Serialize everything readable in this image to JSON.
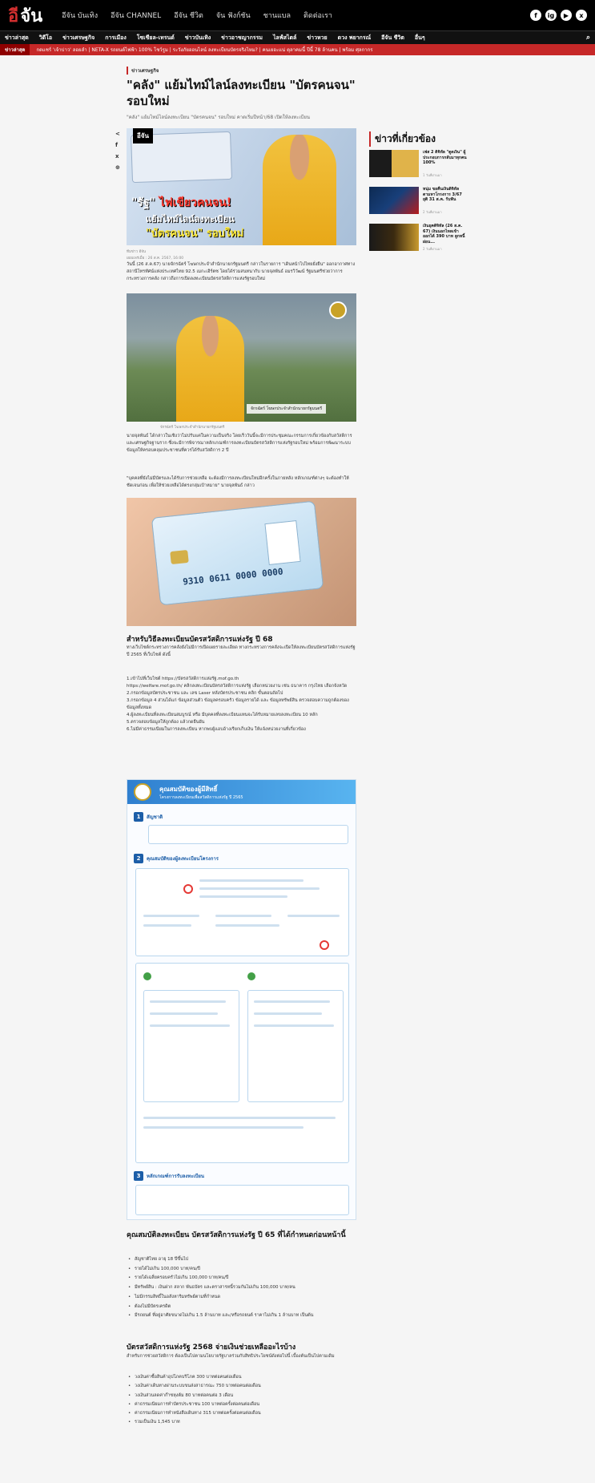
{
  "site": {
    "logo_mark": "อี",
    "logo_text": "จัน",
    "top_links": [
      "อีจัน บันเทิง",
      "อีจัน CHANNEL",
      "อีจัน ชีวิต",
      "จัน ฟังก์ชัน",
      "ชานแบล",
      "ติดต่อเรา"
    ],
    "social_icons": [
      "f",
      "ig",
      "▶",
      "x"
    ]
  },
  "nav": {
    "items": [
      "ข่าวล่าสุด",
      "วิดีโอ",
      "ข่าวเศรษฐกิจ",
      "การเมือง",
      "โซเชียล-เทรนด์",
      "ข่าวบันเทิง",
      "ข่าวอาชญากรรม",
      "ไลฟ์สไตล์",
      "ข่าวหวย",
      "ดวง พยากรณ์",
      "อีจัน ชีวิต",
      "อื่นๆ"
    ],
    "search_icon": "⌕"
  },
  "ticker": {
    "label": "ข่าวล่าสุด",
    "text": "กดแชร์ 'เจ้าบ่าว' ลอยลำ | NETA-X รถยนต์ไฟฟ้า 100% โชว์รูม | ระวังภัยออนไลน์ ลงทะเบียนบัตรจริงไหม? | คนเยอะแน่ ตุลาคมนี้ ปีนี้ 78 ล้านคน | พร้อม ศุลกากร"
  },
  "article": {
    "category": "ข่าวเศรษฐกิจ",
    "title": "\"คลัง\" แย้มไทม์ไลน์ลงทะเบียน \"บัตรคนจน\" รอบใหม่",
    "subtitle": "\"คลัง\" แย้มไทม์ไลน์ลงทะเบียน \"บัตรคนจน\" รอบใหม่ คาดเริ่มปีหน้า/68 เปิดให้ลงทะเบียน",
    "share_icons": [
      "<",
      "f",
      "x",
      "⊕"
    ],
    "hero": {
      "ribbon": "อีจัน",
      "line1_a": "\"รัฐ\"",
      "line1_b": "ไฟเขียวคนจน!",
      "line2": "แย้มไทม์ไลน์ลงทะเบียน",
      "line3": "\"บัตรคนจน\" รอบใหม่"
    },
    "meta_author": "ทีมข่าว อีจัน",
    "meta_date": "เผยแพร่เมื่อ : 26 ส.ค. 2567, 16:00",
    "p1": "วันนี้ (26 ส.ค.67) นายจักรฉัตร์ โฆษกประจำสำนักนายกรัฐมนตรี กล่าวในรายการ \"เดินหน้าไปไทยยั่งยืน\" ออกอากาศทางสถานีโทรทัศน์แห่งประเทศไทย 92.5 เมกะเฮิร์ตซ โดยได้ร่วมสนทนากับ นายจุลพันธ์ อมรวิวัฒน์ รัฐมนตรีช่วยว่าการกระทรวงการคลัง กล่าวถึงการเปิดลงทะเบียนบัตรสวัสดิการแห่งรัฐรอบใหม่",
    "img2_lower": "จักรฉัตร์ โฆษกประจำสำนักนายกรัฐมนตรี",
    "caption": "จักรฉัตร์ โฆษกประจำสำนักนายกรัฐมนตรี",
    "p2": "นายจุลพันธ์ ได้กล่าวในเชิงว่าไม่ปรับแค่ในความเป็นจริง โดยเร็ววันนี้จะมีการประชุมคณะกรรมการเกี่ยวข้องกับสวัสดิการและเศรษฐกิจฐานราก ซึ่งจะมีการพิจารณาหลักเกณฑ์การลงทะเบียนบัตรสวัสดิการแห่งรัฐรอบใหม่ พร้อมการพัฒนาระบบข้อมูลให้ครอบคลุมประชาชนที่ควรได้รับสวัสดิการ 2 ปี",
    "p3": "\"บุคคลที่ยังไม่มีบัตรและได้รับการช่วยเหลือ จะต้องมีการลงทะเบียนใหม่อีกครั้งในภายหลัง หลักเกณฑ์ต่างๆ จะต้องทำให้ชัดเจนก่อน เพื่อให้ช่วยเหลือได้ตรงกลุ่มเป้าหมาย\" นายจุลพันธ์ กล่าว",
    "card_number": "9310 0611 0000 0000",
    "sec1_title": "สำหรับวิธีลงทะเบียนบัตรสวัสดิการแห่งรัฐ ปี 68",
    "sec1_p": "ทางเว็บไซต์กระทรวงการคลังยังไม่มีการเปิดเผยรายละเอียด ทางกระทรวงการคลังจะเปิดให้ลงทะเบียนบัตรสวัสดิการแห่งรัฐ ปี 2565 ที่เว็บไซต์ ดังนี้",
    "steps": [
      "1.เข้าไปที่เว็บไซต์ https://บัตรสวัสดิการแห่งรัฐ.mof.go.th",
      "https://welfare.mof.go.th/ คลิกลงทะเบียนบัตรสวัสดิการแห่งรัฐ เลือกหน่วยงาน เช่น ธนาคาร กรุงไทย เลือกจังหวัด",
      "2.กรอกข้อมูลบัตรประชาชน และ เลข Laser หลังบัตรประชาชน คลิก ขั้นตอนถัดไป",
      "3.กรอกข้อมูล 4 ส่วนได้แก่ ข้อมูลส่วนตัว ข้อมูลครอบครัว ข้อมูลรายได้ และ ข้อมูลทรัพย์สิน ตรวจสอบความถูกต้องของข้อมูลทั้งหมด",
      "4.ผู้ลงทะเบียนที่ลงทะเบียนสมบูรณ์ หรือ มีบุคคลที่ลงทะเบียนแทนจะได้รับหมายเลขลงทะเบียน 10 หลัก",
      "5.ตรวจสอบข้อมูลให้ถูกต้อง แล้วกดยืนยัน",
      "6.ไม่มีค่าธรรมเนียมในการลงทะเบียน หากพบผู้แอบอ้างเรียกเก็บเงิน ให้แจ้งหน่วยงานที่เกี่ยวข้อง"
    ],
    "info": {
      "title": "คุณสมบัติของผู้มีสิทธิ์",
      "sub": "โครงการลงทะเบียนเพื่อสวัสดิการแห่งรัฐ ปี 2565",
      "s1": "สัญชาติ",
      "s2": "คุณสมบัติของผู้ลงทะเบียนโครงการ",
      "s3": "หลักเกณฑ์การรับลงทะเบียน"
    },
    "sec2_title": "คุณสมบัติลงทะเบียน บัตรสวัสดิการแห่งรัฐ ปี 65 ที่ได้กำหนดก่อนหน้านี้",
    "list1": [
      "สัญชาติไทย อายุ 18 ปีขึ้นไป",
      "รายได้ไม่เกิน 100,000 บาท/คน/ปี",
      "รายได้เฉลี่ยครอบครัวไม่เกิน 100,000 บาท/คน/ปี",
      "มีทรัพย์สิน : เงินฝาก สลาก พันธบัตร และตราสารหนี้รวมกันไม่เกิน 100,000 บาท/คน",
      "ไม่มีกรรมสิทธิ์ในอสังหาริมทรัพย์ตามที่กำหนด",
      "ต้องไม่มีบัตรเครดิต",
      "มีรถยนต์ ที่อยู่อาศัยขนาดไม่เกิน 1.5 ล้านบาท และ/หรือรถยนต์ ราคาไม่เกิน 1 ล้านบาท เป็นต้น"
    ],
    "sec3_title": "บัตรสวัสดิการแห่งรัฐ 2568 จ่ายเงินช่วยเหลืออะไรบ้าง",
    "sec3_p": "สำหรับการช่วยสวัสดิการ ต้องเป็นไปตามนโยบายรัฐบาลร่วมกับสิทธิประโยชน์ดังต่อไปนี้ เบื้องต้นเป็นไปตามเดิม",
    "list2": [
      "วงเงินค่าซื้อสินค้าอุปโภคบริโภค 300 บาทต่อคนต่อเดือน",
      "วงเงินค่าเดินทางผ่านระบบขนส่งสาธารณะ 750 บาทต่อคนต่อเดือน",
      "วงเงินส่วนลดค่าก๊าซหุงต้ม 80 บาทต่อคนต่อ 3 เดือน",
      "ค่าธรรมเนียมการทำบัตรประชาชน 100 บาทต่อครั้งต่อคนต่อเดือน",
      "ค่าธรรมเนียมการทำหนังสือเดินทาง 315 บาทต่อครั้งต่อคนต่อเดือน",
      "รวมเป็นเงิน 1,545 บาท"
    ]
  },
  "sidebar": {
    "title": "ข่าวที่เกี่ยวข้อง",
    "items": [
      {
        "title": "เฟส 2 ดิจิทัล \"ดูดเงิน\" ผู้ประกอบการกลับมาทุกคน 100%",
        "date": "1 วันที่ผ่านมา"
      },
      {
        "title": "หนุ่ม ขอคืนเงินดิจิทัล ตามหาโกรงการ 3/67 ยุติ 31 ส.ค. รับฟัน",
        "date": "2 วันที่ผ่านมา"
      },
      {
        "title": "เงินยุคดิจิทัล (26 ส.ค. 67) เงินนอกไหลเข้า ออกได้ 390 บาท ลูกหนี้ผ่อน...",
        "date": "2 วันที่ผ่านมา"
      }
    ]
  }
}
